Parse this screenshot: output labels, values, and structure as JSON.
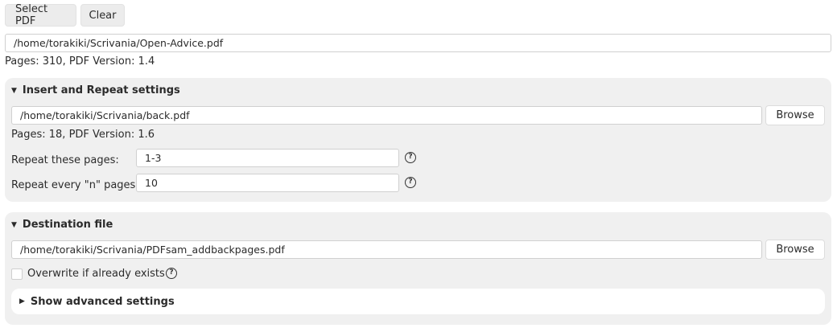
{
  "toolbar": {
    "select_label": "Select PDF",
    "clear_label": "Clear"
  },
  "source": {
    "path": "/home/torakiki/Scrivania/Open-Advice.pdf",
    "info": "Pages: 310, PDF Version: 1.4"
  },
  "insert_panel": {
    "title": "Insert and Repeat settings",
    "file_path": "/home/torakiki/Scrivania/back.pdf",
    "browse_label": "Browse",
    "info": "Pages: 18, PDF Version: 1.6",
    "repeat_pages_label": "Repeat these pages:",
    "repeat_pages_value": "1-3",
    "repeat_every_label": "Repeat every \"n\" pages:",
    "repeat_every_value": "10"
  },
  "destination_panel": {
    "title": "Destination file",
    "file_path": "/home/torakiki/Scrivania/PDFsam_addbackpages.pdf",
    "browse_label": "Browse",
    "overwrite_label": "Overwrite if already exists",
    "advanced_label": "Show advanced settings"
  },
  "icons": {
    "expanded": "triangle-down-icon",
    "collapsed": "triangle-right-icon",
    "help": "question-circle-icon"
  }
}
